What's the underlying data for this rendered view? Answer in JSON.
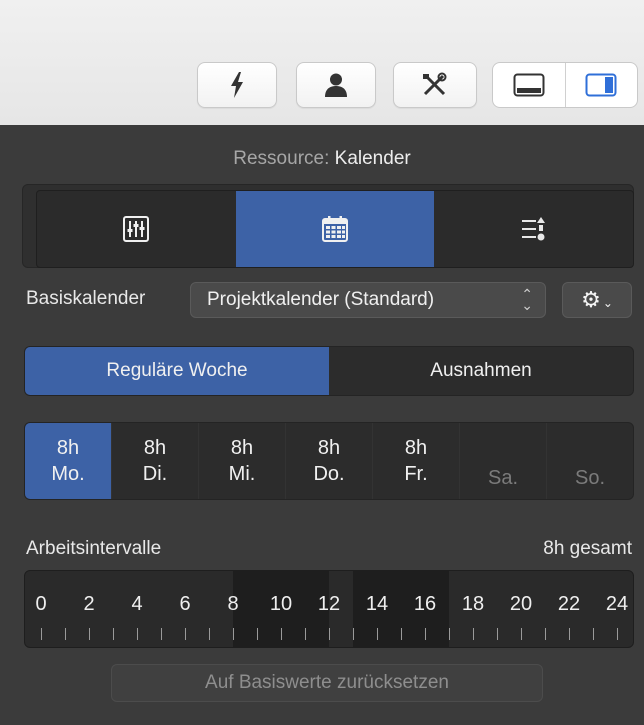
{
  "toolbar": {
    "buttons": [
      {
        "icon": "lightning-icon"
      },
      {
        "icon": "person-icon"
      },
      {
        "icon": "tools-icon"
      },
      {
        "icon": "bottom-panel-icon"
      },
      {
        "icon": "right-sidebar-icon"
      }
    ]
  },
  "header": {
    "label": "Ressource:",
    "value": "Kalender"
  },
  "tabs": [
    {
      "icon": "sliders-icon",
      "active": false
    },
    {
      "icon": "calendar-icon",
      "active": true
    },
    {
      "icon": "list-sort-icon",
      "active": false
    }
  ],
  "basis": {
    "label": "Basiskalender",
    "selected": "Projektkalender (Standard)",
    "arrows_up": "⌃",
    "arrows_down": "⌄",
    "gear": "⚙",
    "gear_chevron": "⌄"
  },
  "week": {
    "regular": "Reguläre Woche",
    "exceptions": "Ausnahmen",
    "active": "regular"
  },
  "days": [
    {
      "hours": "8h",
      "name": "Mo.",
      "active": true
    },
    {
      "hours": "8h",
      "name": "Di.",
      "active": false
    },
    {
      "hours": "8h",
      "name": "Mi.",
      "active": false
    },
    {
      "hours": "8h",
      "name": "Do.",
      "active": false
    },
    {
      "hours": "8h",
      "name": "Fr.",
      "active": false
    },
    {
      "hours": "",
      "name": "Sa.",
      "active": false
    },
    {
      "hours": "",
      "name": "So.",
      "active": false
    }
  ],
  "intervals": {
    "label": "Arbeitsintervalle",
    "total": "8h gesamt",
    "hour_labels": [
      "0",
      "2",
      "4",
      "6",
      "8",
      "10",
      "12",
      "14",
      "16",
      "18",
      "20",
      "22",
      "24"
    ],
    "work_blocks": [
      [
        8,
        12
      ],
      [
        13,
        17
      ]
    ]
  },
  "reset": {
    "label": "Auf Basiswerte zurücksetzen"
  },
  "colors": {
    "accent": "#3d62a6",
    "panel": "#3b3b3b",
    "toolbar": "#ececec"
  }
}
